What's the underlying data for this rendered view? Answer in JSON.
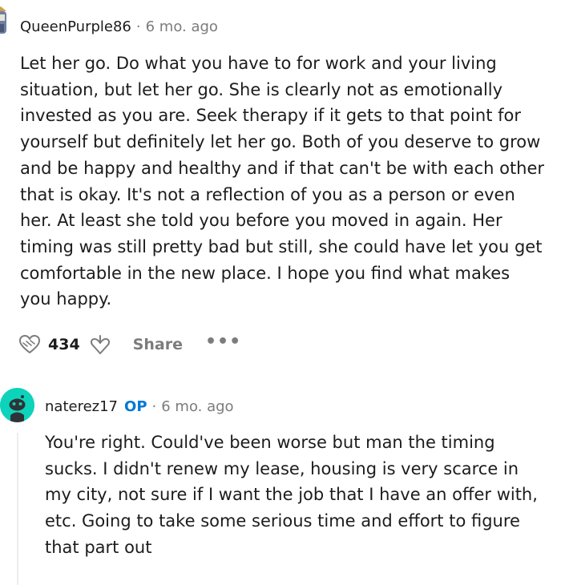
{
  "comments": [
    {
      "username": "QueenPurple86",
      "separator": "·",
      "time": "6 mo. ago",
      "body": "Let her go. Do what you have to for work and your living\nsituation, but let her go. She is clearly not as emotionally\ninvested as you are. Seek therapy if it gets to that point for\nyourself but definitely let her go. Both of you deserve to grow\nand be happy and healthy and if that can't be with each other\nthat is okay. It's not a reflection of you as a person or even\nher. At least she told you before you moved in again. Her\ntiming was still pretty bad but still, she could have let you get\ncomfortable in the new place. I hope you find what makes\nyou happy.",
      "score": "434",
      "share_label": "Share",
      "more_label": "•••",
      "upvote_icon": "upvote-heart-icon",
      "downvote_icon": "downvote-icon"
    },
    {
      "username": "naterez17",
      "op_badge": "OP",
      "separator": "·",
      "time": "6 mo. ago",
      "body": "You're right. Could've been worse but man the timing\nsucks. I didn't renew my lease, housing is very scarce in\nmy city, not sure if I want the job that I have an offer with,\netc. Going to take some serious time and effort to figure\nthat part out",
      "avatar_color": "#0dd3bb"
    }
  ]
}
